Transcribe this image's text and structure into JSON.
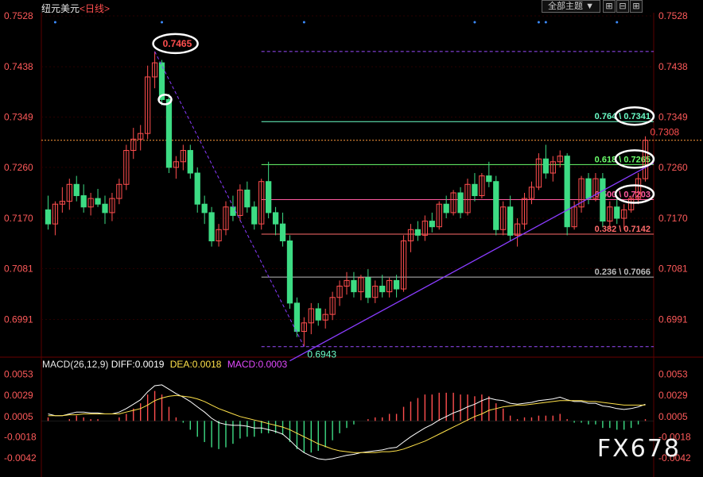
{
  "header": {
    "title": "纽元美元",
    "period": "<日线>",
    "theme_button": "全部主题",
    "theme_arrow": "▼",
    "icons": [
      "grid-icon",
      "zoom-out-icon",
      "zoom-in-icon"
    ]
  },
  "colors": {
    "up": "#ff4e4e",
    "down": "#3ddc84",
    "background": "#000000",
    "grid": "#2a0000",
    "axis_text": "#ff5a5a",
    "trendline": "#8a3cff",
    "dif": "#ffffff",
    "dea": "#ffe24a"
  },
  "chart_data": [
    {
      "type": "candlestick",
      "instrument": "纽元美元",
      "period": "日线",
      "yticks": [
        "0.7528",
        "0.7438",
        "0.7349",
        "0.7260",
        "0.7170",
        "0.7081",
        "0.6991"
      ],
      "ylim": [
        0.693,
        0.7528
      ],
      "n_bars": 104,
      "last_price": 0.7308,
      "high_label": "0.7465",
      "low_label": "0.6943",
      "last_label": "0.7308",
      "fibonacci": {
        "from_price": 0.6943,
        "to_price": 0.7465,
        "levels": [
          {
            "label": "0.236 \\ 0.7066",
            "ratio": 0.236,
            "price": 0.7066,
            "color": "#bbbbbb"
          },
          {
            "label": "0.382 \\ 0.7142",
            "ratio": 0.382,
            "price": 0.7142,
            "color": "#ff6b6b"
          },
          {
            "label": "0.500 \\ 0.7203",
            "ratio": 0.5,
            "price": 0.7203,
            "color": "#ff5aa0"
          },
          {
            "label": "0.618 \\ 0.7265",
            "ratio": 0.618,
            "price": 0.7265,
            "color": "#6bff6b"
          },
          {
            "label": "0.764 \\ 0.7341",
            "ratio": 0.764,
            "price": 0.7341,
            "color": "#6bffc8"
          }
        ],
        "extra_dashed_levels": [
          0.7465,
          0.6943
        ]
      },
      "trendline": {
        "description": "rising support",
        "from": [
          0.6943
        ],
        "to": [
          0.7265
        ]
      },
      "circled_labels": [
        "0.7465",
        "0.7341",
        "0.7265",
        "0.7203"
      ],
      "candles": [
        [
          0.7185,
          0.721,
          0.715,
          0.716
        ],
        [
          0.716,
          0.72,
          0.714,
          0.7195
        ],
        [
          0.7195,
          0.7225,
          0.718,
          0.72
        ],
        [
          0.72,
          0.724,
          0.7185,
          0.723
        ],
        [
          0.723,
          0.7245,
          0.72,
          0.721
        ],
        [
          0.721,
          0.723,
          0.718,
          0.719
        ],
        [
          0.719,
          0.7215,
          0.7175,
          0.7205
        ],
        [
          0.7205,
          0.7222,
          0.719,
          0.7195
        ],
        [
          0.7195,
          0.721,
          0.716,
          0.718
        ],
        [
          0.718,
          0.7215,
          0.7165,
          0.7205
        ],
        [
          0.7205,
          0.724,
          0.7195,
          0.723
        ],
        [
          0.723,
          0.73,
          0.722,
          0.729
        ],
        [
          0.729,
          0.733,
          0.7275,
          0.731
        ],
        [
          0.731,
          0.7335,
          0.729,
          0.732
        ],
        [
          0.732,
          0.744,
          0.731,
          0.742
        ],
        [
          0.742,
          0.7465,
          0.74,
          0.7445
        ],
        [
          0.7445,
          0.745,
          0.737,
          0.738
        ],
        [
          0.738,
          0.739,
          0.725,
          0.726
        ],
        [
          0.726,
          0.728,
          0.724,
          0.727
        ],
        [
          0.727,
          0.73,
          0.7255,
          0.729
        ],
        [
          0.729,
          0.73,
          0.724,
          0.725
        ],
        [
          0.725,
          0.726,
          0.718,
          0.7195
        ],
        [
          0.7195,
          0.721,
          0.716,
          0.718
        ],
        [
          0.718,
          0.719,
          0.712,
          0.713
        ],
        [
          0.713,
          0.716,
          0.712,
          0.715
        ],
        [
          0.715,
          0.72,
          0.714,
          0.719
        ],
        [
          0.719,
          0.721,
          0.7165,
          0.7175
        ],
        [
          0.7175,
          0.723,
          0.7165,
          0.722
        ],
        [
          0.722,
          0.7235,
          0.718,
          0.719
        ],
        [
          0.719,
          0.72,
          0.715,
          0.716
        ],
        [
          0.716,
          0.724,
          0.715,
          0.7235
        ],
        [
          0.7235,
          0.727,
          0.717,
          0.718
        ],
        [
          0.718,
          0.719,
          0.714,
          0.716
        ],
        [
          0.716,
          0.718,
          0.712,
          0.713
        ],
        [
          0.713,
          0.714,
          0.701,
          0.702
        ],
        [
          0.702,
          0.703,
          0.696,
          0.697
        ],
        [
          0.697,
          0.6995,
          0.6943,
          0.6985
        ],
        [
          0.6985,
          0.702,
          0.6965,
          0.701
        ],
        [
          0.701,
          0.702,
          0.698,
          0.699
        ],
        [
          0.699,
          0.701,
          0.6975,
          0.7
        ],
        [
          0.7,
          0.704,
          0.699,
          0.703
        ],
        [
          0.703,
          0.706,
          0.7015,
          0.705
        ],
        [
          0.705,
          0.7075,
          0.7035,
          0.706
        ],
        [
          0.706,
          0.7075,
          0.703,
          0.704
        ],
        [
          0.704,
          0.707,
          0.7025,
          0.7065
        ],
        [
          0.7065,
          0.708,
          0.702,
          0.703
        ],
        [
          0.703,
          0.706,
          0.702,
          0.705
        ],
        [
          0.705,
          0.707,
          0.703,
          0.704
        ],
        [
          0.704,
          0.7065,
          0.703,
          0.706
        ],
        [
          0.706,
          0.707,
          0.703,
          0.7045
        ],
        [
          0.7045,
          0.714,
          0.704,
          0.713
        ],
        [
          0.713,
          0.716,
          0.711,
          0.715
        ],
        [
          0.715,
          0.7165,
          0.713,
          0.714
        ],
        [
          0.714,
          0.7175,
          0.713,
          0.7165
        ],
        [
          0.7165,
          0.718,
          0.7145,
          0.7155
        ],
        [
          0.7155,
          0.72,
          0.715,
          0.7195
        ],
        [
          0.7195,
          0.721,
          0.717,
          0.718
        ],
        [
          0.718,
          0.722,
          0.7175,
          0.7215
        ],
        [
          0.7215,
          0.7225,
          0.717,
          0.718
        ],
        [
          0.718,
          0.724,
          0.7175,
          0.723
        ],
        [
          0.723,
          0.725,
          0.72,
          0.721
        ],
        [
          0.721,
          0.725,
          0.7205,
          0.7245
        ],
        [
          0.7245,
          0.727,
          0.7225,
          0.7235
        ],
        [
          0.7235,
          0.7245,
          0.714,
          0.715
        ],
        [
          0.715,
          0.72,
          0.714,
          0.719
        ],
        [
          0.719,
          0.721,
          0.713,
          0.714
        ],
        [
          0.714,
          0.717,
          0.712,
          0.716
        ],
        [
          0.716,
          0.7215,
          0.715,
          0.7205
        ],
        [
          0.7205,
          0.7235,
          0.7195,
          0.7225
        ],
        [
          0.7225,
          0.7285,
          0.722,
          0.7275
        ],
        [
          0.7275,
          0.73,
          0.724,
          0.725
        ],
        [
          0.725,
          0.728,
          0.7235,
          0.727
        ],
        [
          0.727,
          0.729,
          0.726,
          0.728
        ],
        [
          0.728,
          0.7285,
          0.714,
          0.7155
        ],
        [
          0.7155,
          0.72,
          0.715,
          0.719
        ],
        [
          0.719,
          0.7245,
          0.718,
          0.724
        ],
        [
          0.724,
          0.725,
          0.7195,
          0.7205
        ],
        [
          0.7205,
          0.725,
          0.72,
          0.724
        ],
        [
          0.724,
          0.725,
          0.7155,
          0.7165
        ],
        [
          0.7165,
          0.72,
          0.715,
          0.719
        ],
        [
          0.719,
          0.721,
          0.716,
          0.717
        ],
        [
          0.717,
          0.7195,
          0.715,
          0.7185
        ],
        [
          0.7185,
          0.721,
          0.718,
          0.7205
        ],
        [
          0.7205,
          0.725,
          0.7195,
          0.724
        ],
        [
          0.724,
          0.7315,
          0.7235,
          0.7308
        ]
      ]
    },
    {
      "type": "macd",
      "params": "MACD(26,12,9)",
      "diff_label": "DIFF:0.0019",
      "dea_label": "DEA:0.0018",
      "macd_label": "MACD:0.0003",
      "yticks": [
        "0.0053",
        "0.0029",
        "0.0005",
        "-0.0018",
        "-0.0042"
      ],
      "ylim": [
        -0.0052,
        0.0058
      ],
      "dif": [
        0.0008,
        0.0006,
        0.0006,
        0.0008,
        0.001,
        0.001,
        0.0009,
        0.0009,
        0.0008,
        0.0008,
        0.001,
        0.0014,
        0.0019,
        0.0024,
        0.0033,
        0.004,
        0.0041,
        0.0036,
        0.0031,
        0.0027,
        0.0022,
        0.0016,
        0.001,
        0.0003,
        -0.0002,
        -0.0004,
        -0.0005,
        -0.0005,
        -0.0006,
        -0.0008,
        -0.0008,
        -0.001,
        -0.0012,
        -0.0015,
        -0.0022,
        -0.003,
        -0.0036,
        -0.004,
        -0.0043,
        -0.0044,
        -0.0043,
        -0.0041,
        -0.0039,
        -0.0038,
        -0.0036,
        -0.0035,
        -0.0034,
        -0.0033,
        -0.0031,
        -0.003,
        -0.0024,
        -0.0018,
        -0.0013,
        -0.0008,
        -0.0004,
        0.0001,
        0.0005,
        0.0009,
        0.0012,
        0.0016,
        0.0019,
        0.0023,
        0.0026,
        0.0024,
        0.0023,
        0.002,
        0.0019,
        0.002,
        0.0021,
        0.0023,
        0.0024,
        0.0025,
        0.0027,
        0.0024,
        0.0022,
        0.0022,
        0.002,
        0.002,
        0.0017,
        0.0016,
        0.0014,
        0.0013,
        0.0014,
        0.0016,
        0.0019
      ],
      "dea": [
        0.0006,
        0.0006,
        0.0006,
        0.0007,
        0.0007,
        0.0008,
        0.0008,
        0.0008,
        0.0008,
        0.0008,
        0.0008,
        0.001,
        0.0012,
        0.0014,
        0.0018,
        0.0023,
        0.0026,
        0.0028,
        0.0029,
        0.0028,
        0.0027,
        0.0025,
        0.0022,
        0.0018,
        0.0014,
        0.0011,
        0.0008,
        0.0005,
        0.0003,
        0.0001,
        -0.0001,
        -0.0003,
        -0.0005,
        -0.0007,
        -0.001,
        -0.0014,
        -0.0018,
        -0.0022,
        -0.0026,
        -0.0029,
        -0.0032,
        -0.0034,
        -0.0035,
        -0.0036,
        -0.0036,
        -0.0036,
        -0.0036,
        -0.0035,
        -0.0035,
        -0.0034,
        -0.0032,
        -0.0029,
        -0.0026,
        -0.0023,
        -0.0019,
        -0.0015,
        -0.0011,
        -0.0007,
        -0.0003,
        0.0001,
        0.0005,
        0.0008,
        0.0012,
        0.0014,
        0.0016,
        0.0017,
        0.0018,
        0.0018,
        0.0019,
        0.002,
        0.0021,
        0.0022,
        0.0023,
        0.0023,
        0.0023,
        0.0023,
        0.0022,
        0.0022,
        0.0021,
        0.002,
        0.0019,
        0.0018,
        0.0018,
        0.0018,
        0.0018
      ]
    }
  ],
  "watermark": "FX678"
}
